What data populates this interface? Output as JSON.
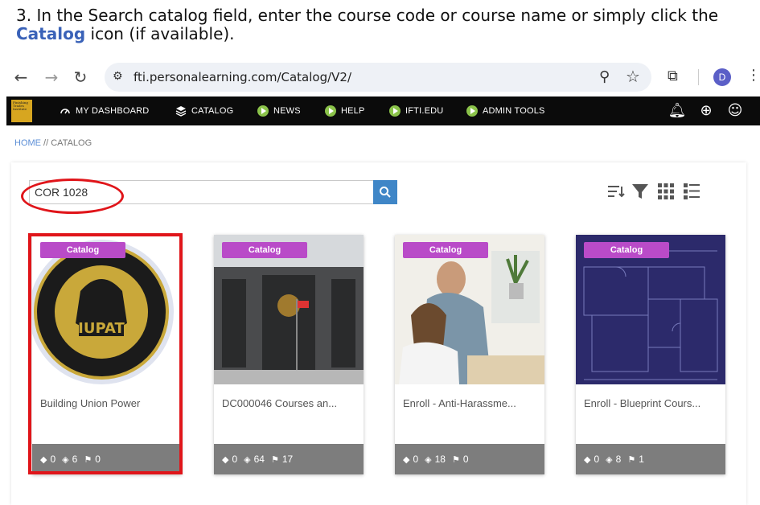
{
  "instruction": {
    "prefix": "3.  In the Search catalog field, enter the course code or course name or simply click the ",
    "link_word": "Catalog",
    "suffix": " icon (if available)."
  },
  "browser": {
    "back_icon": "arrow-left-icon",
    "forward_icon": "arrow-right-icon",
    "reload_icon": "reload-icon",
    "url": "fti.personalearning.com/Catalog/V2/",
    "profile_initial": "D"
  },
  "nav": {
    "items": [
      {
        "label": "MY DASHBOARD",
        "icon": "dashboard-icon"
      },
      {
        "label": "CATALOG",
        "icon": "layers-icon"
      },
      {
        "label": "NEWS",
        "icon": "play-icon"
      },
      {
        "label": "HELP",
        "icon": "play-icon"
      },
      {
        "label": "IFTI.EDU",
        "icon": "play-icon"
      },
      {
        "label": "ADMIN TOOLS",
        "icon": "play-icon"
      }
    ],
    "accent": "#8bc34a"
  },
  "breadcrumb": {
    "home": "HOME",
    "current": " // CATALOG"
  },
  "search": {
    "value": "COR 1028"
  },
  "cards": [
    {
      "badge": "Catalog",
      "title": "Building Union Power",
      "stats": [
        "0",
        "6",
        "0"
      ]
    },
    {
      "badge": "Catalog",
      "title": "DC000046 Courses an...",
      "stats": [
        "0",
        "64",
        "17"
      ]
    },
    {
      "badge": "Catalog",
      "title": "Enroll - Anti-Harassme...",
      "stats": [
        "0",
        "18",
        "0"
      ]
    },
    {
      "badge": "Catalog",
      "title": "Enroll - Blueprint Cours...",
      "stats": [
        "0",
        "8",
        "1"
      ]
    }
  ],
  "colors": {
    "badge": "#b94bc8",
    "highlight": "#e0151a",
    "search_button": "#3f86c7"
  }
}
